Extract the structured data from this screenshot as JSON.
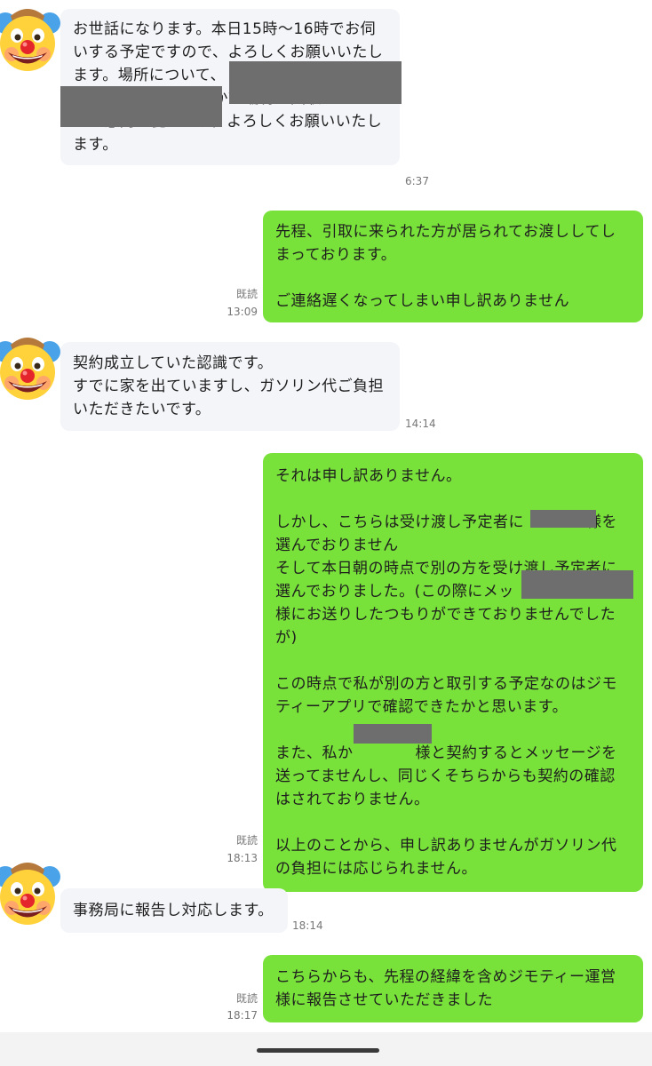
{
  "messages": [
    {
      "side": "in",
      "paragraphs": [
        "お世話になります。本日15時〜16時でお伺いする予定ですので、よろしくお願いいたします。場所について、　　　　　　　　　　　　　　　　　　　　　　でよかったでしょうか？端材の回収についてはご意向に従います。よろしくお願いいたします。"
      ],
      "time": "6:37"
    },
    {
      "side": "out",
      "paragraphs": [
        "先程、引取に来られた方が居られてお渡ししてしまっております。",
        "ご連絡遅くなってしまい申し訳ありません"
      ],
      "read": "既読",
      "time": "13:09"
    },
    {
      "side": "in",
      "paragraphs": [
        "契約成立していた認識です。\nすでに家を出ていますし、ガソリン代ご負担いただきたいです。"
      ],
      "time": "14:14"
    },
    {
      "side": "out",
      "paragraphs": [
        "それは申し訳ありません。",
        "しかし、こちらは受け渡し予定者に　　　　様を選んでおりません\nそして本日朝の時点で別の方を受け渡し予定者に選んでおりました。(この際にメッ　　　　　　ー様にお送りしたつもりができておりませんでしたが)",
        "この時点で私が別の方と取引する予定なのはジモティーアプリで確認できたかと思います。",
        "また、私か　　　　様と契約するとメッセージを送ってませんし、同じくそちらからも契約の確認はされておりません。",
        "以上のことから、申し訳ありませんがガソリン代の負担には応じられません。"
      ],
      "read": "既読",
      "time": "18:13"
    },
    {
      "side": "in",
      "paragraphs": [
        "事務局に報告し対応します。"
      ],
      "time": "18:14"
    },
    {
      "side": "out",
      "paragraphs": [
        "こちらからも、先程の経緯を含めジモティー運営様に報告させていただきました"
      ],
      "read": "既読",
      "time": "18:17"
    }
  ],
  "colors": {
    "incoming_bubble": "#f4f5f9",
    "outgoing_bubble": "#79e23a",
    "redaction": "#6e6e6e"
  },
  "icons": {
    "avatar": "clown-face-icon"
  }
}
